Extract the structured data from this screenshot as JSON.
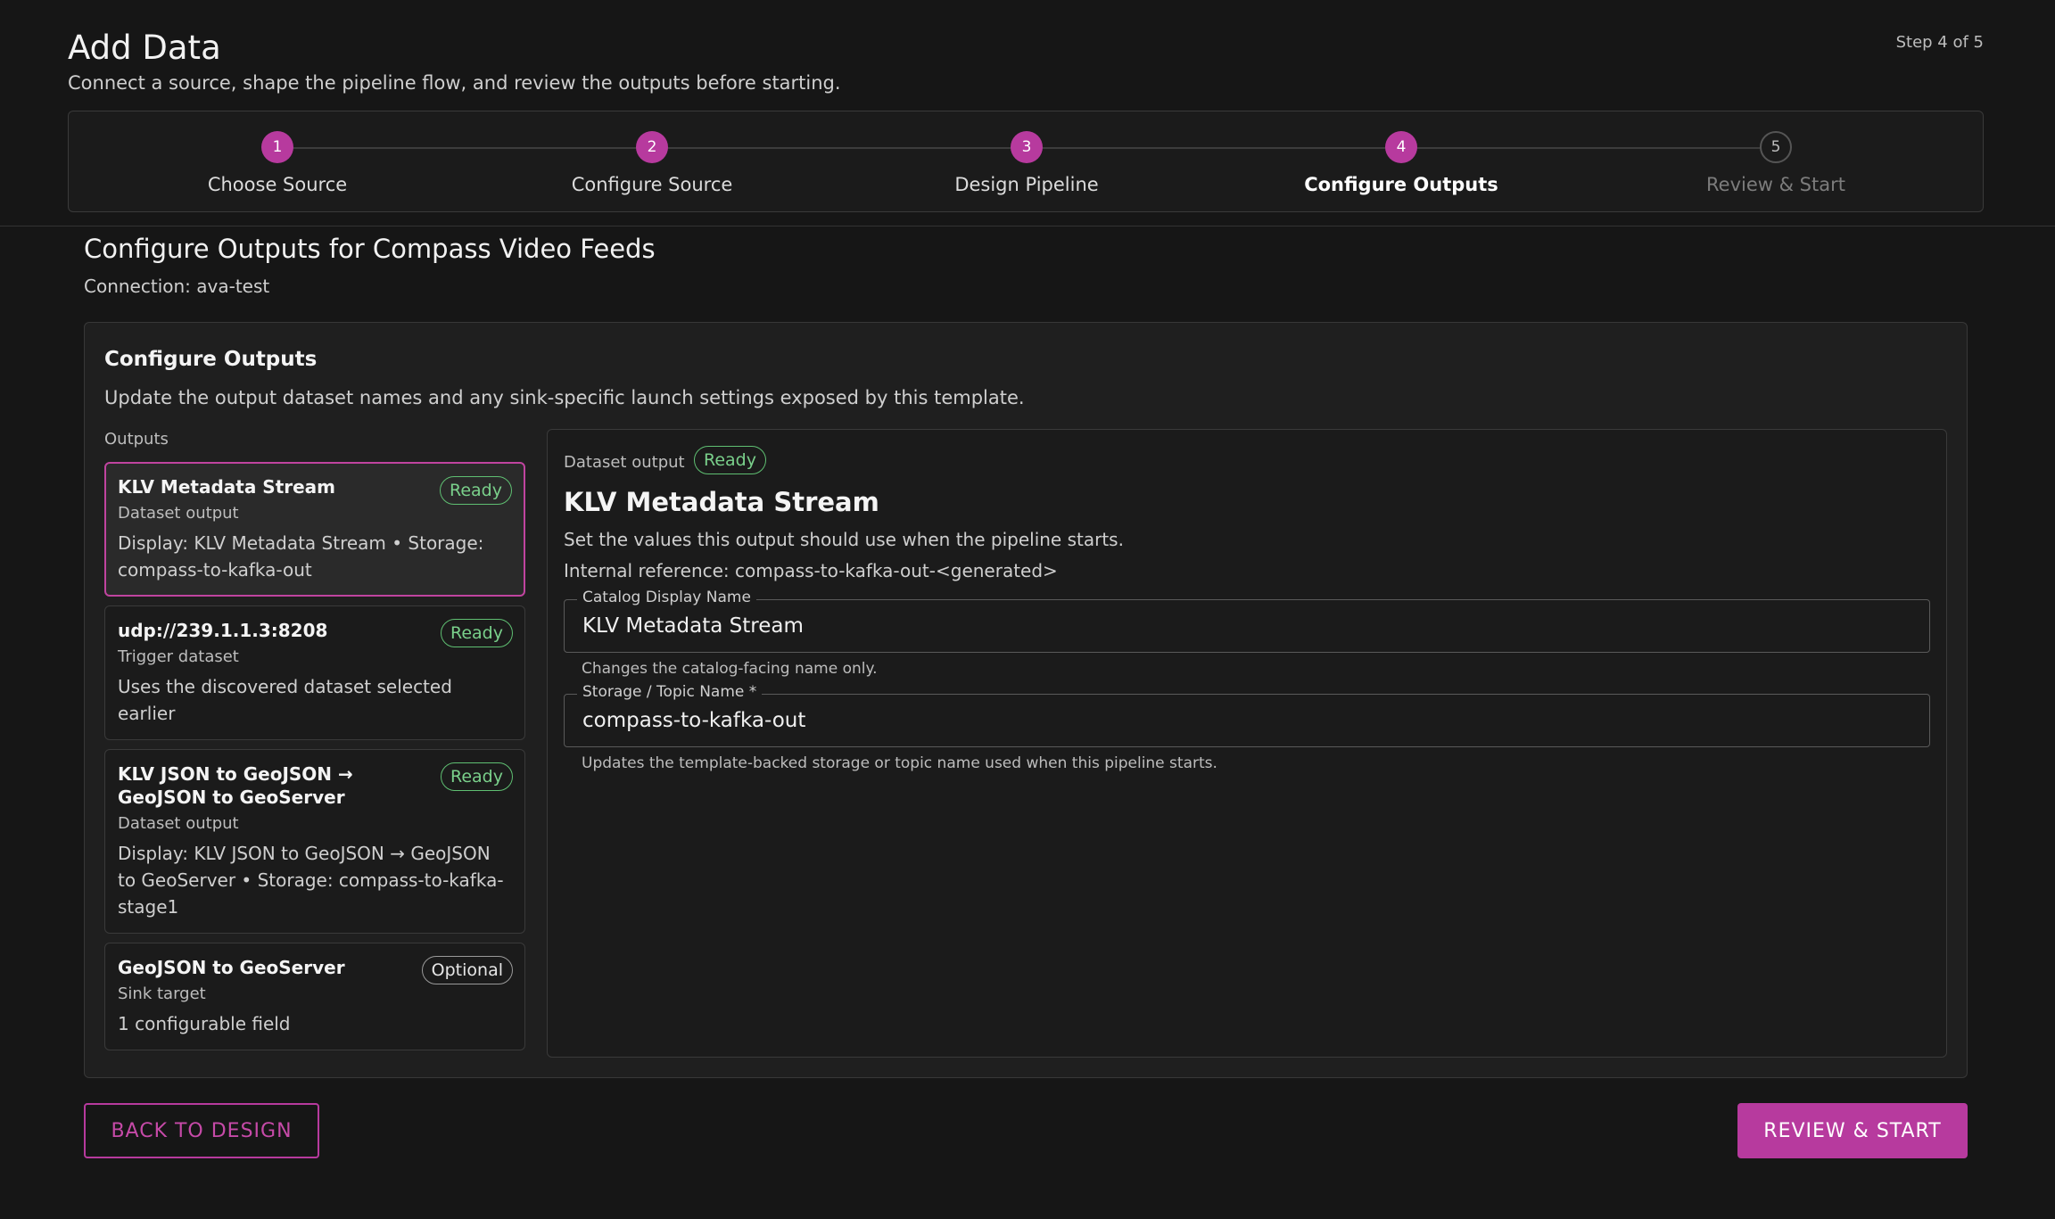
{
  "header": {
    "title": "Add Data",
    "subtitle": "Connect a source, shape the pipeline flow, and review the outputs before starting.",
    "step_indicator": "Step 4 of 5"
  },
  "stepper": {
    "steps": [
      {
        "number": "1",
        "label": "Choose Source",
        "state": "complete"
      },
      {
        "number": "2",
        "label": "Configure Source",
        "state": "complete"
      },
      {
        "number": "3",
        "label": "Design Pipeline",
        "state": "complete"
      },
      {
        "number": "4",
        "label": "Configure Outputs",
        "state": "active"
      },
      {
        "number": "5",
        "label": "Review & Start",
        "state": "pending"
      }
    ]
  },
  "section": {
    "title": "Configure Outputs for Compass Video Feeds",
    "connection": "Connection: ava-test"
  },
  "card": {
    "title": "Configure Outputs",
    "description": "Update the output dataset names and any sink-specific launch settings exposed by this template.",
    "outputs_label": "Outputs"
  },
  "outputs": [
    {
      "title": "KLV Metadata Stream",
      "type": "Dataset output",
      "description": "Display: KLV Metadata Stream • Storage: compass-to-kafka-out",
      "badge": "Ready",
      "selected": true
    },
    {
      "title": "udp://239.1.1.3:8208",
      "type": "Trigger dataset",
      "description": "Uses the discovered dataset selected earlier",
      "badge": "Ready",
      "selected": false
    },
    {
      "title": "KLV JSON to GeoJSON → GeoJSON to GeoServer",
      "type": "Dataset output",
      "description": "Display: KLV JSON to GeoJSON → GeoJSON to GeoServer • Storage: compass-to-kafka-stage1",
      "badge": "Ready",
      "selected": false
    },
    {
      "title": "GeoJSON to GeoServer",
      "type": "Sink target",
      "description": "1 configurable field",
      "badge": "Optional",
      "selected": false
    }
  ],
  "detail": {
    "kind": "Dataset output",
    "badge": "Ready",
    "title": "KLV Metadata Stream",
    "description": "Set the values this output should use when the pipeline starts.",
    "internal_reference": "Internal reference: compass-to-kafka-out-<generated>",
    "display_name_label": "Catalog Display Name",
    "display_name_value": "KLV Metadata Stream",
    "display_name_helper": "Changes the catalog-facing name only.",
    "storage_label": "Storage / Topic Name *",
    "storage_value": "compass-to-kafka-out",
    "storage_helper": "Updates the template-backed storage or topic name used when this pipeline starts."
  },
  "footer": {
    "back_label": "BACK TO DESIGN",
    "review_label": "REVIEW & START"
  },
  "colors": {
    "accent": "#b73a9e",
    "ready": "#5fbf72",
    "background": "#161616"
  }
}
